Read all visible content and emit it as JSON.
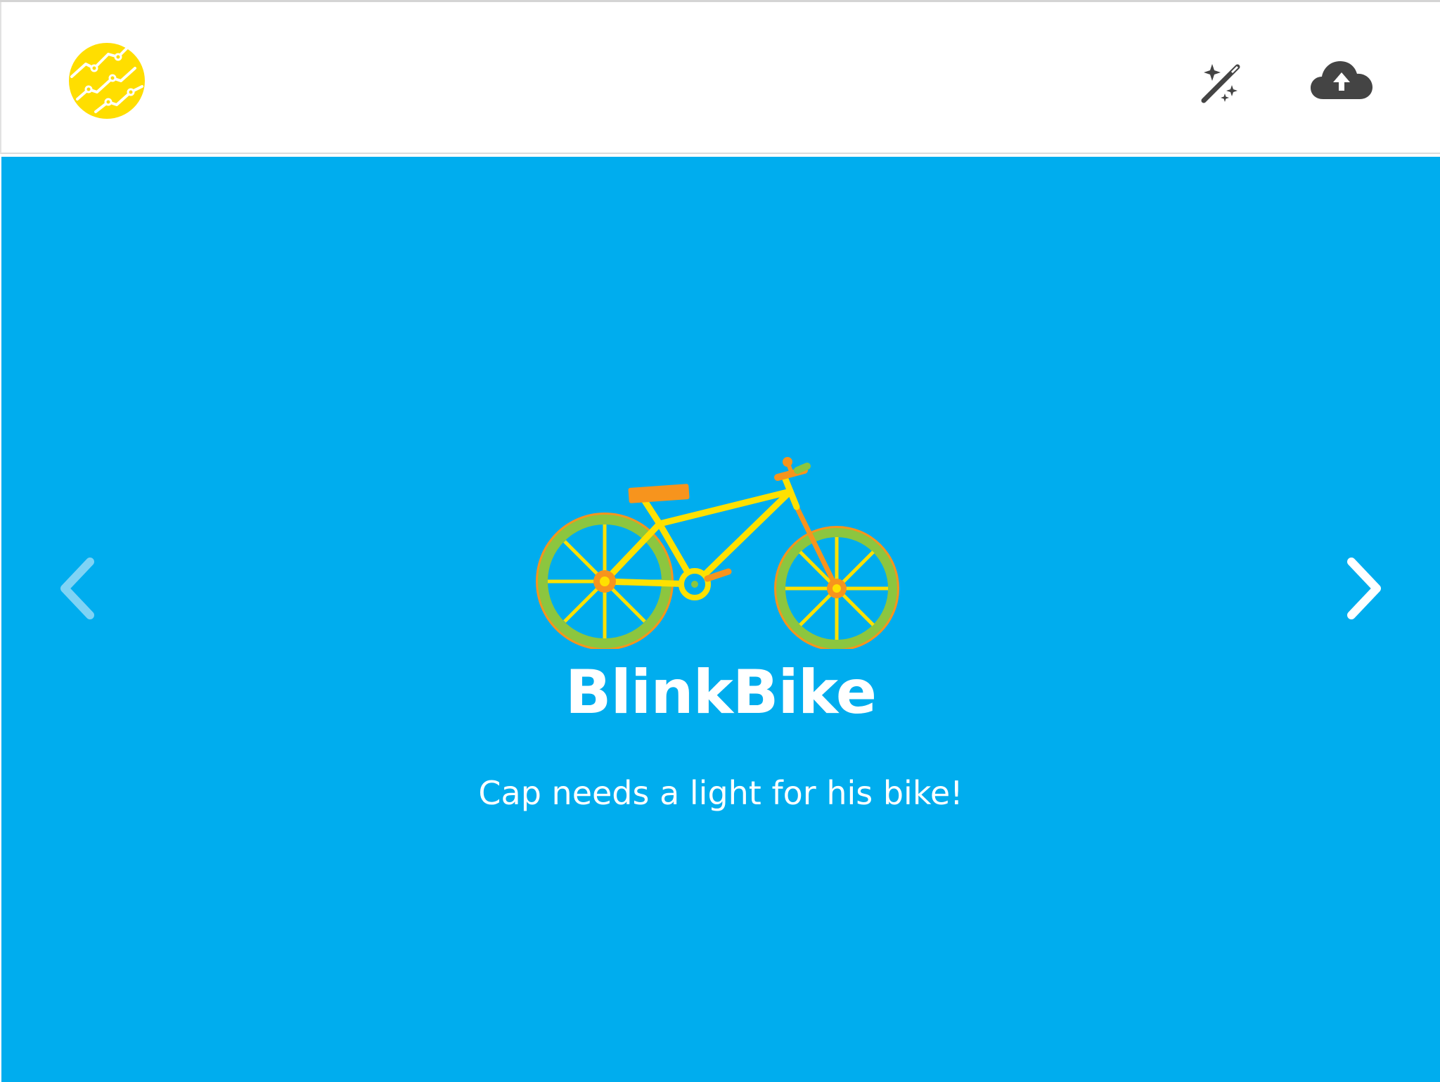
{
  "header": {
    "logo_icon": "chart-badge-icon",
    "actions": [
      {
        "icon": "magic-wand-icon"
      },
      {
        "icon": "cloud-upload-icon"
      }
    ]
  },
  "carousel": {
    "prev_icon": "chevron-left-icon",
    "next_icon": "chevron-right-icon",
    "item": {
      "image_icon": "bicycle-icon",
      "title": "BlinkBike",
      "description": "Cap needs a light for his bike!"
    }
  },
  "colors": {
    "stage_background": "#00adee",
    "logo_yellow": "#ffde00",
    "icon_dark": "#444444",
    "bike_frame": "#ffe100",
    "bike_wheel": "#8cc63f",
    "bike_accent": "#f7941d"
  }
}
